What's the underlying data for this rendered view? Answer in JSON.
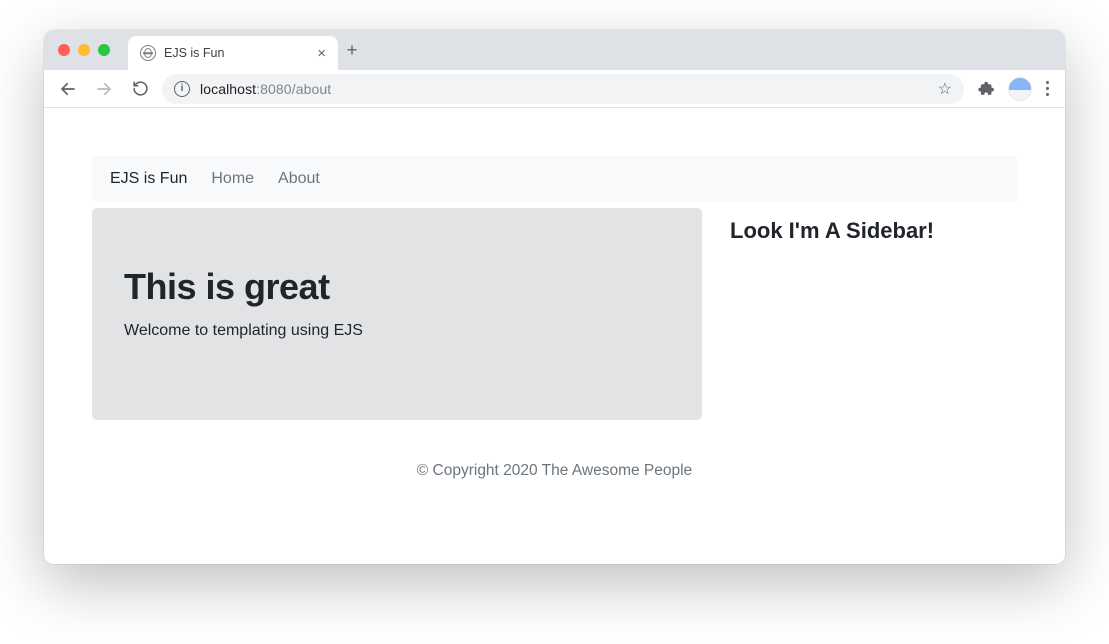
{
  "window": {
    "tab_title": "EJS is Fun",
    "url_host": "localhost",
    "url_port": ":8080",
    "url_path": "/about"
  },
  "navbar": {
    "brand": "EJS is Fun",
    "links": [
      "Home",
      "About"
    ]
  },
  "jumbotron": {
    "heading": "This is great",
    "text": "Welcome to templating using EJS"
  },
  "sidebar": {
    "heading": "Look I'm A Sidebar!"
  },
  "footer": {
    "text": "© Copyright 2020 The Awesome People"
  }
}
